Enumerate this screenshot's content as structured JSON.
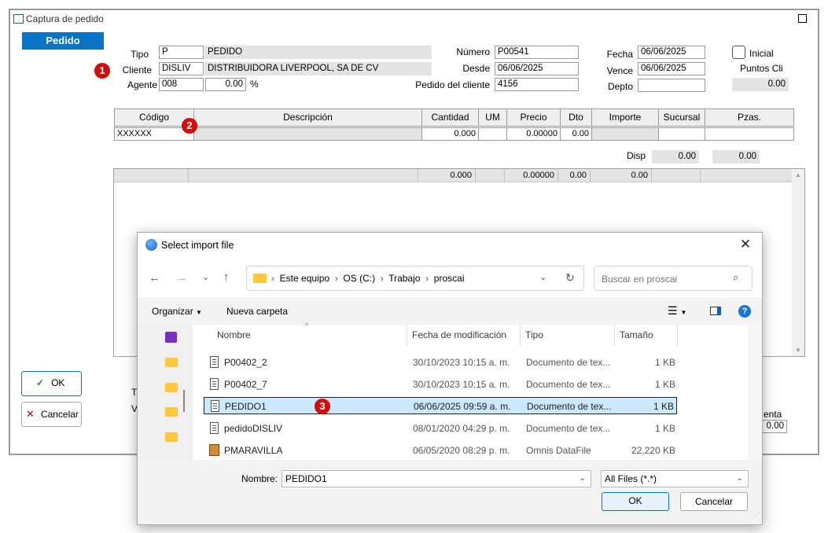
{
  "window": {
    "title": "Captura de pedido",
    "header_button": "Pedido"
  },
  "form": {
    "tipo_label": "Tipo",
    "tipo_code": "P",
    "tipo_desc": "PEDIDO",
    "cliente_label": "Cliente",
    "cliente_code": "DISLIV",
    "cliente_name": "DISTRIBUIDORA LIVERPOOL, SA DE CV",
    "agente_label": "Agente",
    "agente_code": "008",
    "agente_pct": "0.00",
    "pct_sign": "%",
    "numero_label": "Número",
    "numero": "P00541",
    "desde_label": "Desde",
    "desde": "06/06/2025",
    "pedcli_label": "Pedido del cliente",
    "pedcli": "4156",
    "fecha_label": "Fecha",
    "fecha": "06/06/2025",
    "vence_label": "Vence",
    "vence": "06/06/2025",
    "depto_label": "Depto",
    "depto": "",
    "inicial_label": "Inicial",
    "puntos_label": "Puntos Cli",
    "puntos": "0.00"
  },
  "badges": [
    "1",
    "2",
    "3"
  ],
  "grid": {
    "headers": [
      "Código",
      "Descripción",
      "Cantidad",
      "UM",
      "Precio",
      "Dto",
      "Importe",
      "Sucursal",
      "Pzas."
    ],
    "row": {
      "codigo": "XXXXXX",
      "cantidad": "0.000",
      "precio": "0.00000",
      "dto": "0.00"
    },
    "disp_label": "Disp",
    "disp1": "0.00",
    "disp2": "0.00"
  },
  "list": {
    "cantidad": "0.000",
    "precio": "0.00000",
    "dto": "0.00",
    "importe": "0.00"
  },
  "buttons": {
    "ok": "OK",
    "cancel": "Cancelar"
  },
  "bottom_labels": {
    "t": "T",
    "v": "V",
    "enta": "enta",
    "value": "0.00"
  },
  "dialog": {
    "title": "Select import file",
    "path": [
      "Este equipo",
      "OS (C:)",
      "Trabajo",
      "proscai"
    ],
    "search_placeholder": "Buscar en proscai",
    "organize": "Organizar",
    "new_folder": "Nueva carpeta",
    "columns": [
      "Nombre",
      "Fecha de modificación",
      "Tipo",
      "Tamaño"
    ],
    "files": [
      {
        "name": "P00402_2",
        "date": "30/10/2023 10:15 a. m.",
        "type": "Documento de tex...",
        "size": "1 KB"
      },
      {
        "name": "P00402_7",
        "date": "30/10/2023 10:15 a. m.",
        "type": "Documento de tex...",
        "size": "1 KB"
      },
      {
        "name": "PEDIDO1",
        "date": "06/06/2025 09:59 a. m.",
        "type": "Documento de tex...",
        "size": "1 KB"
      },
      {
        "name": "pedidoDISLIV",
        "date": "08/01/2020 04:29 p. m.",
        "type": "Documento de tex...",
        "size": "1 KB"
      },
      {
        "name": "PMARAVILLA",
        "date": "06/05/2020 08:29 p. m.",
        "type": "Omnis DataFile",
        "size": "22,220 KB"
      }
    ],
    "filename_label": "Nombre:",
    "filename": "PEDIDO1",
    "filter": "All Files (*.*)",
    "ok": "OK",
    "cancel": "Cancelar"
  },
  "colors": {
    "accent": "#0a74c4",
    "badge": "#d10a0a",
    "selection": "#cce8ff"
  }
}
